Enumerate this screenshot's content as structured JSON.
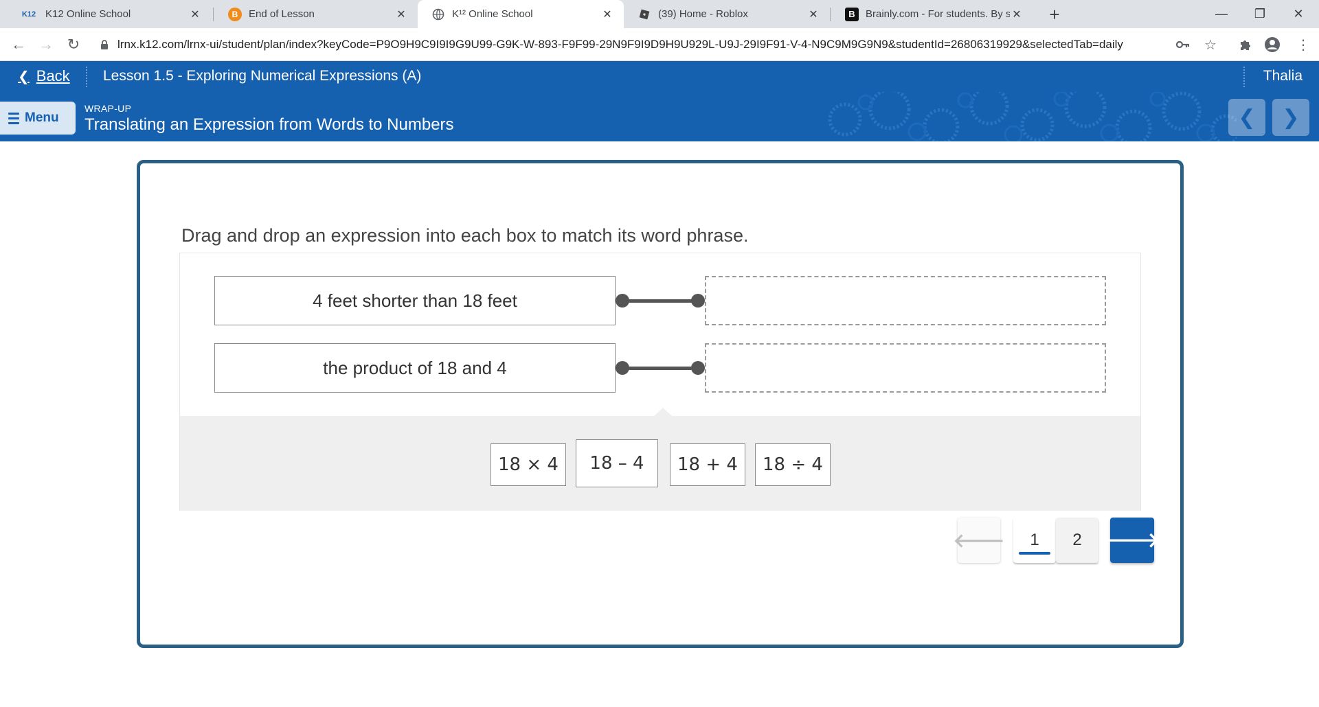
{
  "browser": {
    "tabs": [
      {
        "title": "K12 Online School",
        "favicon": "K12",
        "active": false
      },
      {
        "title": "End of Lesson",
        "favicon": "B",
        "active": false
      },
      {
        "title": "K¹² Online School",
        "favicon": "globe",
        "active": true
      },
      {
        "title": "(39) Home - Roblox",
        "favicon": "roblox",
        "active": false
      },
      {
        "title": "Brainly.com - For students. By stu",
        "favicon": "B",
        "active": false
      }
    ],
    "url": "lrnx.k12.com/lrnx-ui/student/plan/index?keyCode=P9O9H9C9I9I9G9U99-G9K-W-893-F9F99-29N9F9I9D9H9U929L-U9J-29I9F91-V-4-N9C9M9G9N9&studentId=26806319929&selectedTab=daily"
  },
  "header": {
    "back_label": "Back",
    "lesson_title": "Lesson 1.5 - Exploring Numerical Expressions (A)",
    "user_name": "Thalia",
    "menu_label": "Menu",
    "section_label": "WRAP-UP",
    "section_title": "Translating an Expression from Words to Numbers"
  },
  "activity": {
    "instruction": "Drag and drop an expression into each box to match its word phrase.",
    "phrases": [
      "4 feet shorter than 18 feet",
      "the product of 18 and 4"
    ],
    "choices": [
      "18 × 4",
      "18 – 4",
      "18 + 4",
      "18 ÷ 4"
    ]
  },
  "pagination": {
    "pages": [
      "1",
      "2"
    ],
    "current_page": "1"
  },
  "colors": {
    "brand_blue": "#1660b0",
    "card_border": "#2a5f86",
    "tray_bg": "#efefef"
  }
}
